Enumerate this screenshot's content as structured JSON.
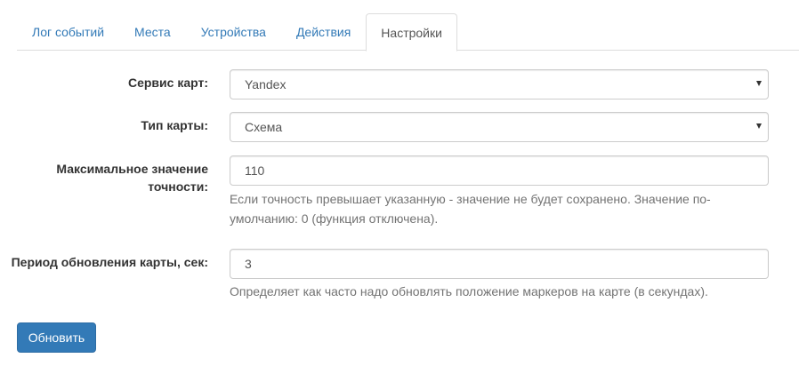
{
  "tabs": [
    {
      "label": "Лог событий"
    },
    {
      "label": "Места"
    },
    {
      "label": "Устройства"
    },
    {
      "label": "Действия"
    },
    {
      "label": "Настройки",
      "active": true
    }
  ],
  "form": {
    "map_service": {
      "label": "Сервис карт:",
      "value": "Yandex"
    },
    "map_type": {
      "label": "Тип карты:",
      "value": "Схема"
    },
    "max_accuracy": {
      "label_line1": "Максимальное значение",
      "label_line2": "точности:",
      "value": "110",
      "help_line1": "Если точность превышает указанную - значение не будет сохранено. Значение по-",
      "help_line2": "умолчанию: 0 (функция отключена)."
    },
    "refresh_period": {
      "label": "Период обновления карты, сек:",
      "value": "3",
      "help": "Определяет как часто надо обновлять положение маркеров на карте (в секундах)."
    }
  },
  "submit_label": "Обновить",
  "colors": {
    "accent": "#337ab7",
    "tab_border": "#dddddd",
    "help_text": "#737373"
  }
}
